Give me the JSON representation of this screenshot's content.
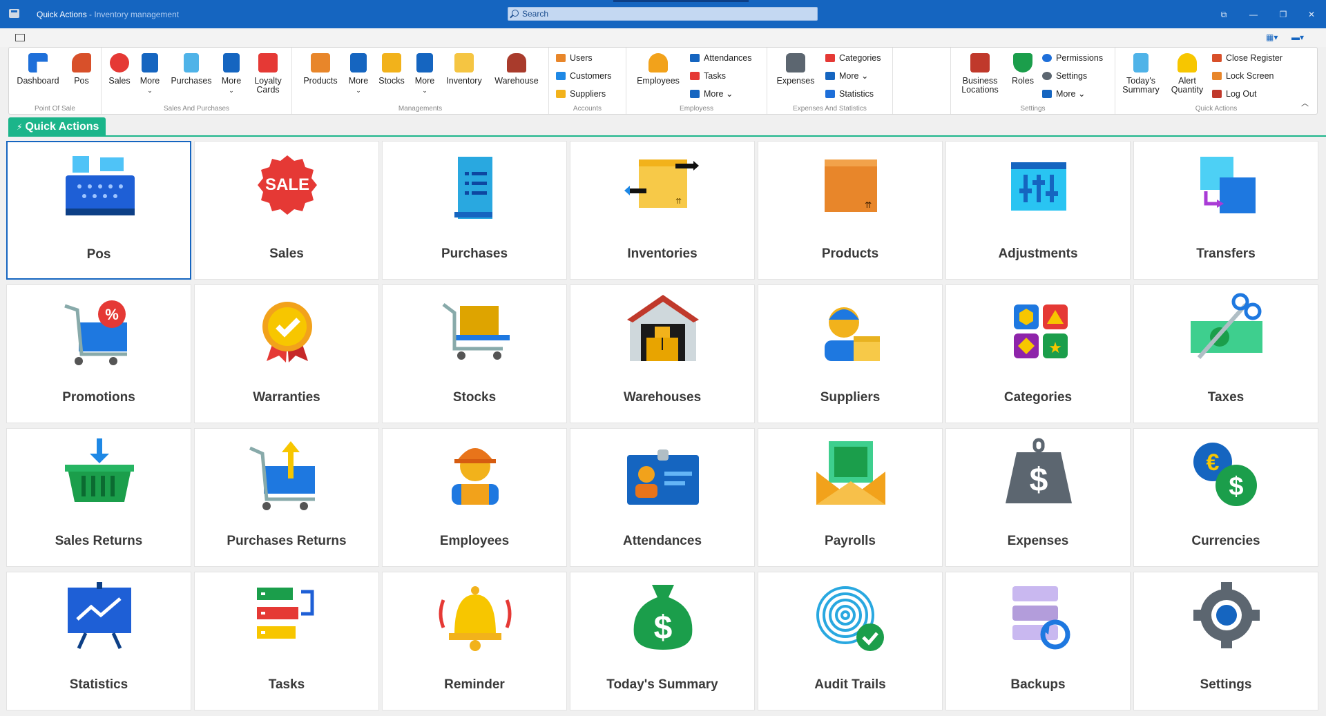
{
  "titlebar": {
    "title": "Quick Actions",
    "subtitle": " - Inventory management",
    "search_placeholder": "Search",
    "window_buttons": [
      "⧉",
      "—",
      "❐",
      "✕"
    ]
  },
  "ribbon": {
    "groups": [
      {
        "label": "Point Of Sale"
      },
      {
        "label": "Sales And Purchases"
      },
      {
        "label": "Managements"
      },
      {
        "label": "Accounts"
      },
      {
        "label": "Employess"
      },
      {
        "label": "Expenses And Statistics"
      },
      {
        "label": ""
      },
      {
        "label": "Settings"
      },
      {
        "label": "Quick Actions"
      }
    ],
    "buttons": {
      "dashboard": "Dashboard",
      "pos": "Pos",
      "sales": "Sales",
      "more1": "More",
      "purchases": "Purchases",
      "more2": "More",
      "loyalty": "Loyalty Cards",
      "products": "Products",
      "more3": "More",
      "stocks": "Stocks",
      "more4": "More",
      "inventory": "Inventory",
      "warehouse": "Warehouse",
      "employees": "Employees",
      "expenses": "Expenses",
      "business": "Business Locations",
      "roles": "Roles",
      "todays": "Today's Summary",
      "alert": "Alert Quantity"
    },
    "small": {
      "users": "Users",
      "customers": "Customers",
      "suppliers": "Suppliers",
      "attendances": "Attendances",
      "tasks": "Tasks",
      "more5": "More",
      "categories": "Categories",
      "more6": "More",
      "statistics": "Statistics",
      "permissions": "Permissions",
      "settings": "Settings",
      "more7": "More",
      "close_register": "Close Register",
      "lock_screen": "Lock Screen",
      "log_out": "Log Out"
    }
  },
  "tab": {
    "label": "Quick Actions"
  },
  "tiles": [
    "Pos",
    "Sales",
    "Purchases",
    "Inventories",
    "Products",
    "Adjustments",
    "Transfers",
    "Promotions",
    "Warranties",
    "Stocks",
    "Warehouses",
    "Suppliers",
    "Categories",
    "Taxes",
    "Sales Returns",
    "Purchases Returns",
    "Employees",
    "Attendances",
    "Payrolls",
    "Expenses",
    "Currencies",
    "Statistics",
    "Tasks",
    "Reminder",
    "Today's Summary",
    "Audit Trails",
    "Backups",
    "Settings"
  ],
  "colors": {
    "titlebar": "#1565c0",
    "accent_tab": "#1bb58a",
    "selection": "#1565c0"
  }
}
